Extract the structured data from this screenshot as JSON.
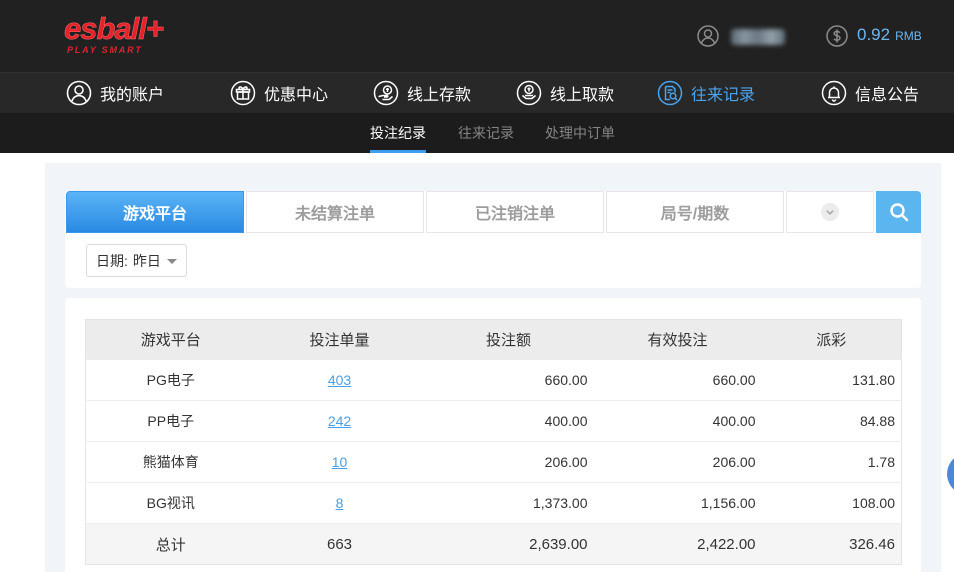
{
  "colors": {
    "header_bg": "#212121",
    "nav_bg": "#282828",
    "subnav_bg": "#1c1c1c",
    "accent": "#4aa4ee",
    "logo_red": "#e3222b",
    "link": "#4a9fe6",
    "search_button": "#5bb5ef",
    "panel_bg": "#f1f5f9"
  },
  "logo": {
    "brand": "esball+",
    "tagline": "PLAY SMART"
  },
  "account": {
    "user_icon": "user-circle-icon",
    "balance_icon": "dollar-circle-icon",
    "balance_amount": "0.92",
    "balance_currency": "RMB"
  },
  "main_nav": {
    "items": [
      {
        "label": "我的账户",
        "icon": "user-icon",
        "active": false
      },
      {
        "label": "优惠中心",
        "icon": "gift-icon",
        "active": false
      },
      {
        "label": "线上存款",
        "icon": "deposit-icon",
        "active": false
      },
      {
        "label": "线上取款",
        "icon": "withdraw-icon",
        "active": false
      },
      {
        "label": "往来记录",
        "icon": "record-icon",
        "active": true
      },
      {
        "label": "信息公告",
        "icon": "bell-icon",
        "active": false
      }
    ]
  },
  "sub_nav": {
    "items": [
      {
        "label": "投注纪录",
        "active": true
      },
      {
        "label": "往来记录",
        "active": false
      },
      {
        "label": "处理中订单",
        "active": false
      }
    ]
  },
  "filter": {
    "tabs": [
      {
        "label": "游戏平台",
        "active": true
      },
      {
        "label": "未结算注单",
        "active": false
      },
      {
        "label": "已注销注单",
        "active": false
      },
      {
        "label": "局号/期数",
        "active": false
      }
    ],
    "more_icon": "chevron-down-icon",
    "search_icon": "search-icon",
    "date": {
      "label": "日期:",
      "value": "昨日"
    }
  },
  "table": {
    "headers": [
      "游戏平台",
      "投注单量",
      "投注额",
      "有效投注",
      "派彩"
    ],
    "rows": [
      {
        "platform": "PG电子",
        "count": "403",
        "bet": "660.00",
        "valid": "660.00",
        "payout": "131.80"
      },
      {
        "platform": "PP电子",
        "count": "242",
        "bet": "400.00",
        "valid": "400.00",
        "payout": "84.88"
      },
      {
        "platform": "熊猫体育",
        "count": "10",
        "bet": "206.00",
        "valid": "206.00",
        "payout": "1.78"
      },
      {
        "platform": "BG视讯",
        "count": "8",
        "bet": "1,373.00",
        "valid": "1,156.00",
        "payout": "108.00"
      }
    ],
    "total": {
      "label": "总计",
      "count": "663",
      "bet": "2,639.00",
      "valid": "2,422.00",
      "payout": "326.46"
    }
  }
}
